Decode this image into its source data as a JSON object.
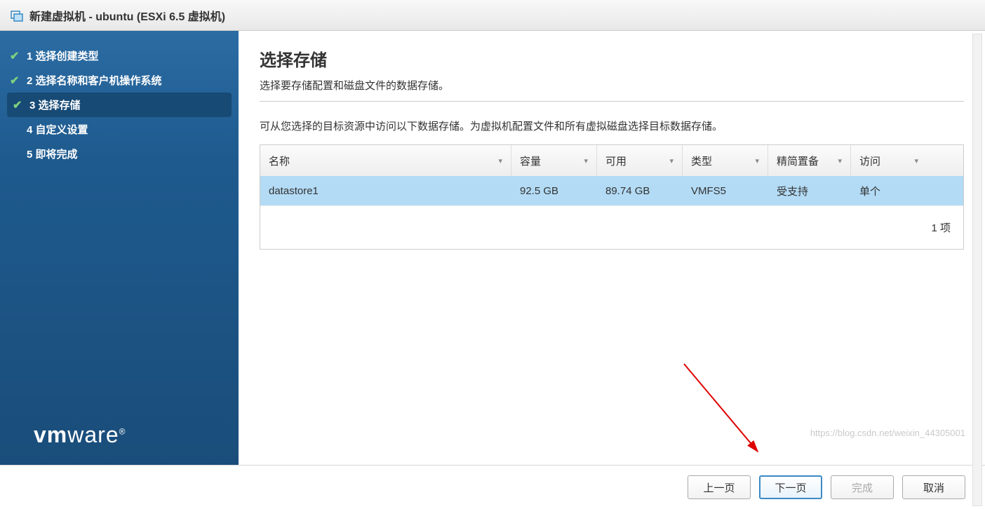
{
  "title": "新建虚拟机 - ubuntu (ESXi 6.5 虚拟机)",
  "steps": [
    {
      "num": "1",
      "label": "选择创建类型",
      "state": "done"
    },
    {
      "num": "2",
      "label": "选择名称和客户机操作系统",
      "state": "done"
    },
    {
      "num": "3",
      "label": "选择存储",
      "state": "current"
    },
    {
      "num": "4",
      "label": "自定义设置",
      "state": "future"
    },
    {
      "num": "5",
      "label": "即将完成",
      "state": "future"
    }
  ],
  "logo": "vmware",
  "page": {
    "heading": "选择存储",
    "subtitle": "选择要存储配置和磁盘文件的数据存储。",
    "description": "可从您选择的目标资源中访问以下数据存储。为虚拟机配置文件和所有虚拟磁盘选择目标数据存储。",
    "columns": {
      "name": "名称",
      "capacity": "容量",
      "free": "可用",
      "type": "类型",
      "thin": "精简置备",
      "access": "访问"
    },
    "rows": [
      {
        "name": "datastore1",
        "capacity": "92.5 GB",
        "free": "89.74 GB",
        "type": "VMFS5",
        "thin": "受支持",
        "access": "单个"
      }
    ],
    "footer_count": "1 项"
  },
  "buttons": {
    "back": "上一页",
    "next": "下一页",
    "finish": "完成",
    "cancel": "取消"
  },
  "watermark": "https://blog.csdn.net/weixin_44305001"
}
